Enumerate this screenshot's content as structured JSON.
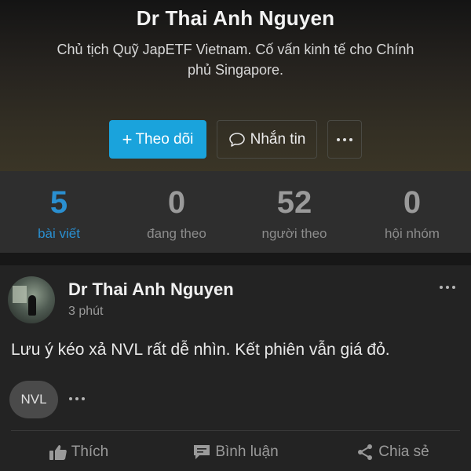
{
  "profile": {
    "name": "Dr Thai Anh Nguyen",
    "bio": "Chủ tịch Quỹ JapETF Vietnam. Cố vấn kinh tế cho Chính phủ Singapore.",
    "follow_label": "Theo dõi",
    "message_label": "Nhắn tin"
  },
  "stats": [
    {
      "value": "5",
      "label": "bài viết"
    },
    {
      "value": "0",
      "label": "đang theo"
    },
    {
      "value": "52",
      "label": "người theo"
    },
    {
      "value": "0",
      "label": "hội nhóm"
    }
  ],
  "post": {
    "author": "Dr Thai Anh Nguyen",
    "time": "3 phút",
    "text": "Lưu ý kéo xả NVL rất dễ nhìn. Kết phiên vẫn giá đỏ.",
    "tag": "NVL",
    "actions": {
      "like": "Thích",
      "comment": "Bình luận",
      "share": "Chia sẻ"
    }
  },
  "colors": {
    "accent": "#1aa3dc",
    "active_stat": "#2a8fd0"
  }
}
